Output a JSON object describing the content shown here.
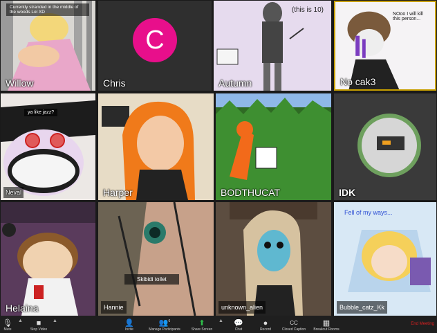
{
  "tiles": [
    {
      "name": "Willow",
      "caption": "Currently stranded in the middle of the woods Lol XD"
    },
    {
      "name": "Chris",
      "avatar_letter": "C",
      "avatar_color": "#e80f8b"
    },
    {
      "name": "Autumn",
      "annotation": "(this is 10)"
    },
    {
      "name": "No cak3",
      "annotation": "NOoo I will kill this person..."
    },
    {
      "name": "Neval",
      "caption": "ya like jazz?"
    },
    {
      "name": "Harper"
    },
    {
      "name": "BODTHUCAT"
    },
    {
      "name": "IDK"
    },
    {
      "name": "Helaina"
    },
    {
      "name": "Hannie",
      "caption": "Skibidi toilet"
    },
    {
      "name": "unknown_alien"
    },
    {
      "name": "Bubble_catz_Kk",
      "annotation": "Fell of my ways..."
    }
  ],
  "toolbar": {
    "mute": "Mute",
    "stop_video": "Stop Video",
    "invite": "Invite",
    "participants": "Manage Participants",
    "participants_count": "6",
    "share": "Share Screen",
    "chat": "Chat",
    "record": "Record",
    "captions": "Closed Caption",
    "breakout": "Breakout Rooms",
    "end": "End Meeting"
  },
  "colors": {
    "end": "#e02020",
    "share": "#2fbf4a",
    "highlight_border": "#c8a000"
  }
}
